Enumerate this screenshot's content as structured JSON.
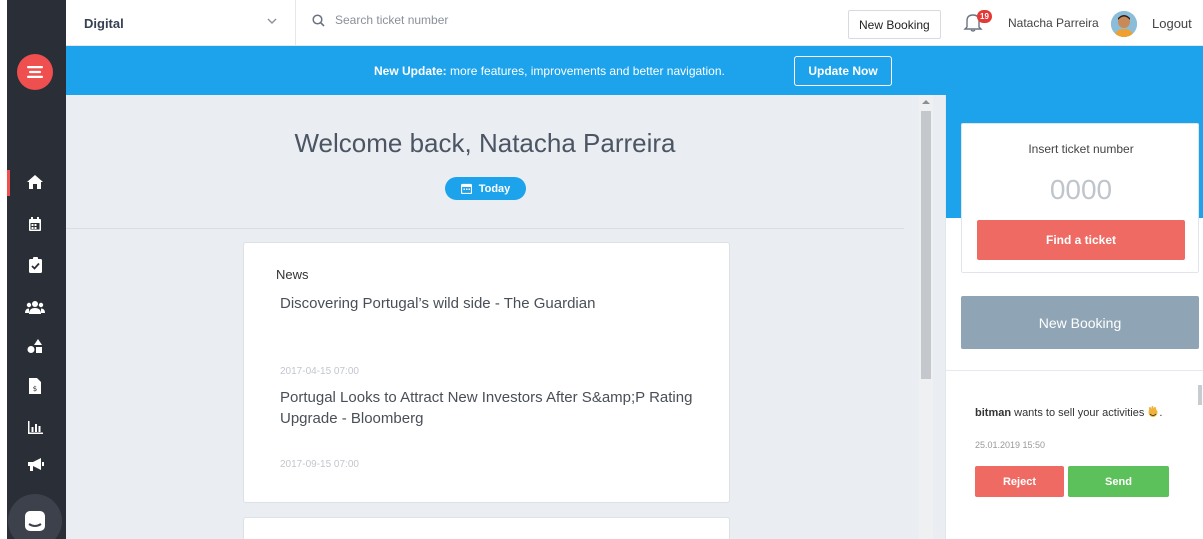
{
  "header": {
    "department": "Digital",
    "search_placeholder": "Search ticket number",
    "new_booking_label": "New Booking",
    "notifications_count": "19",
    "user_name": "Natacha Parreira",
    "logout_label": "Logout"
  },
  "banner": {
    "lead": "New Update:",
    "message": "more features, improvements and better navigation.",
    "button_label": "Update Now"
  },
  "sidebar": {
    "items": [
      {
        "name": "home",
        "icon": "home-icon"
      },
      {
        "name": "calendar",
        "icon": "calendar-icon"
      },
      {
        "name": "tasks",
        "icon": "clipboard-check-icon"
      },
      {
        "name": "customers",
        "icon": "users-icon"
      },
      {
        "name": "activities",
        "icon": "shapes-icon"
      },
      {
        "name": "invoices",
        "icon": "invoice-icon"
      },
      {
        "name": "reports",
        "icon": "bar-chart-icon"
      },
      {
        "name": "marketing",
        "icon": "megaphone-icon"
      }
    ]
  },
  "main": {
    "welcome": "Welcome back, Natacha Parreira",
    "today_label": "Today",
    "news_section": "News",
    "news": [
      {
        "date": "",
        "title": "Discovering Portugal’s wild side - The Guardian"
      },
      {
        "date": "2017-04-15 07:00",
        "title": "Portugal Looks to Attract New Investors After S&amp;P Rating Upgrade - Bloomberg"
      },
      {
        "date": "2017-09-15 07:00",
        "title": ""
      }
    ]
  },
  "right_panel": {
    "ticket_label": "Insert ticket number",
    "ticket_placeholder": "0000",
    "find_label": "Find a ticket",
    "new_booking_label": "New Booking",
    "notification": {
      "user": "bitman",
      "text": "wants to sell your activities",
      "date": "25.01.2019 15:50",
      "reject_label": "Reject",
      "send_label": "Send"
    }
  },
  "colors": {
    "accent_blue": "#1ca3ec",
    "sidebar": "#2a2e36",
    "danger": "#ef6a63",
    "success": "#5cc15a",
    "muted_button": "#8fa4b5"
  }
}
